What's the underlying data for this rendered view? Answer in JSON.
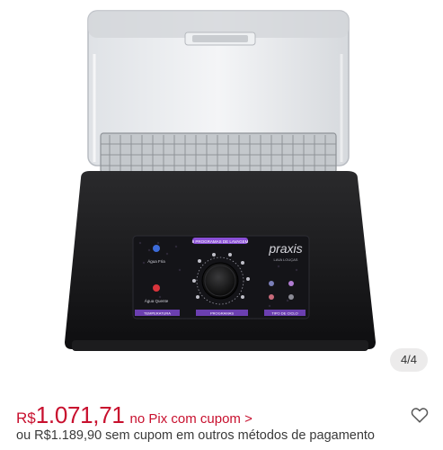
{
  "gallery": {
    "counter": "4/4",
    "product_panel": {
      "brand": "praxis",
      "subtitle": "LAVA LOUÇAS",
      "programs_title": "8 PROGRAMAS DE LAVAGEM",
      "left_labels": [
        "Água Fria",
        "Água Quente"
      ],
      "bottom_labels": [
        "TEMPERATURA",
        "PROGRAMAS",
        "TIPO DE CICLO"
      ]
    }
  },
  "price": {
    "currency": "R$",
    "amount": "1.071,71",
    "pix_text": "no Pix com cupom >",
    "alt_text": "ou R$1.189,90 sem cupom em outros métodos de pagamento"
  },
  "colors": {
    "price_red": "#c8102e",
    "accent_purple": "#8a4fd6"
  },
  "icons": {
    "favorite": "heart-outline-icon"
  }
}
